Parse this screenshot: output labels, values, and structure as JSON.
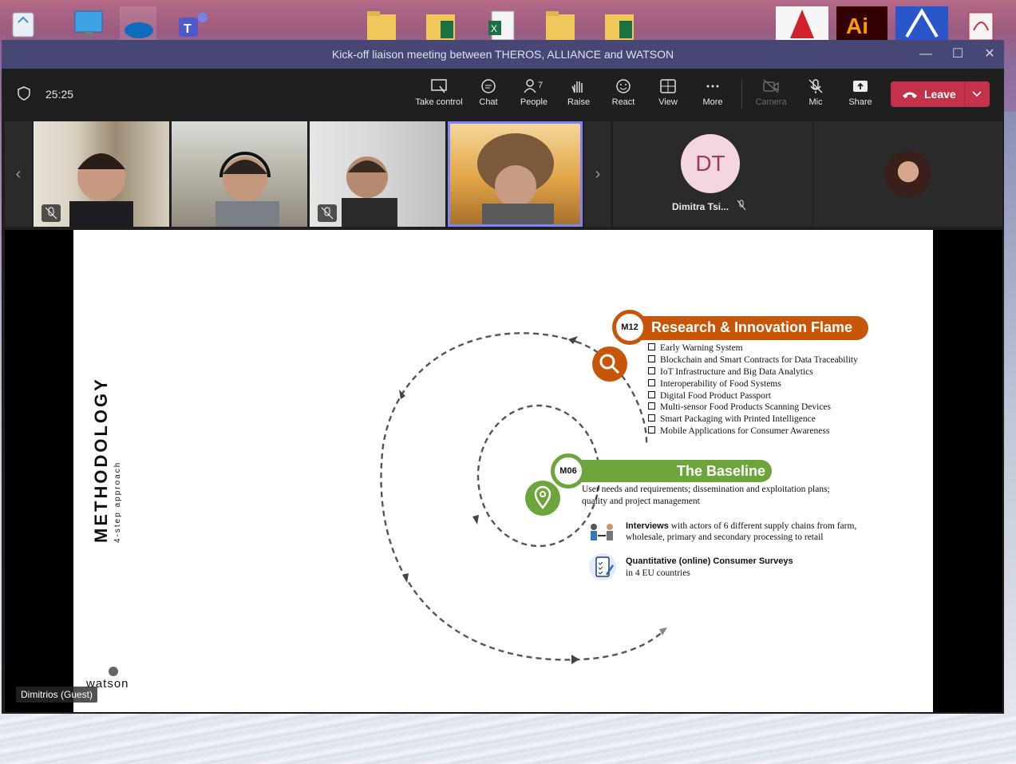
{
  "window": {
    "title": "Kick-off liaison meeting between THEROS, ALLIANCE and WATSON",
    "minimize": "—",
    "maximize": "☐",
    "close": "✕"
  },
  "toolbar": {
    "timer": "25:25",
    "buttons": [
      {
        "label": "Take control",
        "icon": "take-control-icon"
      },
      {
        "label": "Chat",
        "icon": "chat-icon"
      },
      {
        "label": "People",
        "icon": "people-icon",
        "badge": "7"
      },
      {
        "label": "Raise",
        "icon": "raise-hand-icon"
      },
      {
        "label": "React",
        "icon": "react-icon"
      },
      {
        "label": "View",
        "icon": "view-icon"
      },
      {
        "label": "More",
        "icon": "more-icon"
      },
      {
        "label": "Camera",
        "icon": "camera-off-icon"
      },
      {
        "label": "Mic",
        "icon": "mic-off-icon"
      },
      {
        "label": "Share",
        "icon": "share-icon"
      }
    ],
    "leave_label": "Leave"
  },
  "participants": {
    "dt_initials": "DT",
    "dt_name": "Dimitra Tsi..."
  },
  "slide": {
    "title": "METHODOLOGY",
    "subtitle": "4-step approach",
    "m12": {
      "badge": "M12",
      "title": "Research & Innovation Flame",
      "items": [
        "Early Warning System",
        "Blockchain and Smart Contracts for Data Traceability",
        "IoT Infrastructure and Big Data Analytics",
        "Interoperability of Food Systems",
        "Digital Food Product Passport",
        "Multi-sensor Food Products Scanning Devices",
        "Smart Packaging with Printed Intelligence",
        "Mobile Applications for Consumer Awareness"
      ]
    },
    "m06": {
      "badge": "M06",
      "title": "The Baseline",
      "description": "User needs and requirements; dissemination and exploitation plans; quality and project management",
      "interviews_bold": "Interviews",
      "interviews_text": " with actors of 6 different supply chains from farm, wholesale, primary and secondary processing to retail",
      "surveys_bold": "Quantitative (online) Consumer Surveys",
      "surveys_text": "in 4 EU countries"
    },
    "logo_text": "watson"
  },
  "presenter_tag": "Dimitrios (Guest)",
  "colors": {
    "titlebar": "#464775",
    "leave": "#c4314b",
    "orange": "#c8560a",
    "green": "#6ea43c"
  }
}
